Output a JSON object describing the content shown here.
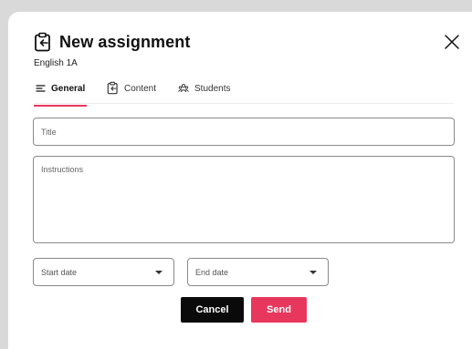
{
  "dialog": {
    "title": "New assignment",
    "subtitle": "English 1A",
    "header_icon": "clipboard-arrow-icon",
    "close_icon": "close-icon"
  },
  "tabs": [
    {
      "label": "General",
      "icon": "list-lines-icon",
      "active": true
    },
    {
      "label": "Content",
      "icon": "clipboard-arrow-icon",
      "active": false
    },
    {
      "label": "Students",
      "icon": "students-group-icon",
      "active": false
    }
  ],
  "form": {
    "title_placeholder": "Title",
    "title_value": "",
    "instructions_placeholder": "Instructions",
    "instructions_value": "",
    "start_date_label": "Start date",
    "end_date_label": "End date"
  },
  "actions": {
    "cancel_label": "Cancel",
    "send_label": "Send"
  },
  "colors": {
    "accent": "#e8375d",
    "primary_dark": "#0a0a0a",
    "border": "#8a8a8a",
    "backdrop": "#d9d9d9"
  }
}
